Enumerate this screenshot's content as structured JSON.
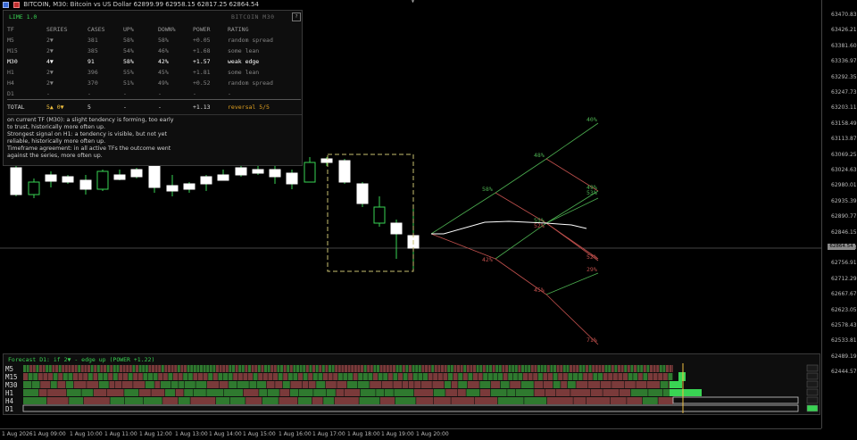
{
  "window": {
    "title": "BITCOIN, M30: Bitcoin vs US Dollar  62899.99 62958.15 62817.25 62864.54"
  },
  "price_axis": {
    "ticks": [
      "63470.83",
      "63426.21",
      "63381.60",
      "63336.97",
      "63292.35",
      "63247.73",
      "63203.11",
      "63158.49",
      "63113.87",
      "63069.25",
      "63024.63",
      "62980.01",
      "62935.39",
      "62890.77",
      "62846.15",
      "62801.53",
      "62756.91",
      "62712.29",
      "62667.67",
      "62623.05",
      "62578.43",
      "62533.81",
      "62489.19",
      "62444.57"
    ],
    "current_price": "62864.54"
  },
  "time_axis": {
    "ticks": [
      "1 Aug 2026",
      "1 Aug 09:00",
      "1 Aug 10:00",
      "1 Aug 11:00",
      "1 Aug 12:00",
      "1 Aug 13:00",
      "1 Aug 14:00",
      "1 Aug 15:00",
      "1 Aug 16:00",
      "1 Aug 17:00",
      "1 Aug 18:00",
      "1 Aug 19:00",
      "1 Aug 20:00"
    ]
  },
  "stats_panel": {
    "title": "LIME 1.0",
    "subtitle": "BITCOIN  M30",
    "help_label": "?",
    "columns": [
      "TF",
      "SERIES",
      "CASES",
      "UP%",
      "DOWN%",
      "POWER",
      "RATING"
    ],
    "rows": [
      {
        "tf": "M5",
        "series": "2▼",
        "cases": "381",
        "up": "58%",
        "down": "58%",
        "power": "+0.05",
        "rating": "random spread",
        "style": "dim"
      },
      {
        "tf": "M15",
        "series": "2▼",
        "cases": "385",
        "up": "54%",
        "down": "46%",
        "power": "+1.68",
        "rating": "some lean",
        "style": "dim"
      },
      {
        "tf": "M30",
        "series": "4▼",
        "cases": "91",
        "up": "58%",
        "down": "42%",
        "power": "+1.57",
        "rating": "weak edge",
        "style": "hl"
      },
      {
        "tf": "H1",
        "series": "2▼",
        "cases": "396",
        "up": "55%",
        "down": "45%",
        "power": "+1.81",
        "rating": "some lean",
        "style": "dim"
      },
      {
        "tf": "H4",
        "series": "2▼",
        "cases": "370",
        "up": "51%",
        "down": "49%",
        "power": "+0.52",
        "rating": "random spread",
        "style": "dim"
      },
      {
        "tf": "D1",
        "series": "-",
        "cases": "-",
        "up": "-",
        "down": "-",
        "power": "-",
        "rating": "-",
        "style": "dim"
      }
    ],
    "total": {
      "label": "TOTAL",
      "series": "5▲ 0▼",
      "cases": "5",
      "up": "-",
      "down": "-",
      "power": "+1.13",
      "rating": "reversal 5/5"
    },
    "info_lines": [
      "on current TF (M30): a slight tendency is forming, too early",
      "to trust, historically more often up.",
      "Strongest signal on H1: a tendency is visible, but not yet",
      "reliable, historically more often up.",
      "Timeframe agreement: in all active TFs the outcome went",
      "against the series, more often up."
    ]
  },
  "forecast_labels": {
    "up": [
      "58%",
      "48%",
      "49%",
      "55%",
      "53%",
      "40%"
    ],
    "down": [
      "42%",
      "52%",
      "45%",
      "52%",
      "29%",
      "71%"
    ]
  },
  "sub_panel": {
    "title": "Forecast D1: if 2▼ - edge up (POWER +1.22)",
    "tf_labels": [
      "M5",
      "M15",
      "M30",
      "H1",
      "H4",
      "D1"
    ]
  },
  "colors": {
    "bull": "#ffffff",
    "bear_body": "#000000",
    "green": "#39d353",
    "band_green": "#2f7a2f",
    "band_red": "#7a3a3a",
    "forecast_up": "#4caf50",
    "forecast_down": "#c0504d",
    "box": "#c8c070"
  }
}
